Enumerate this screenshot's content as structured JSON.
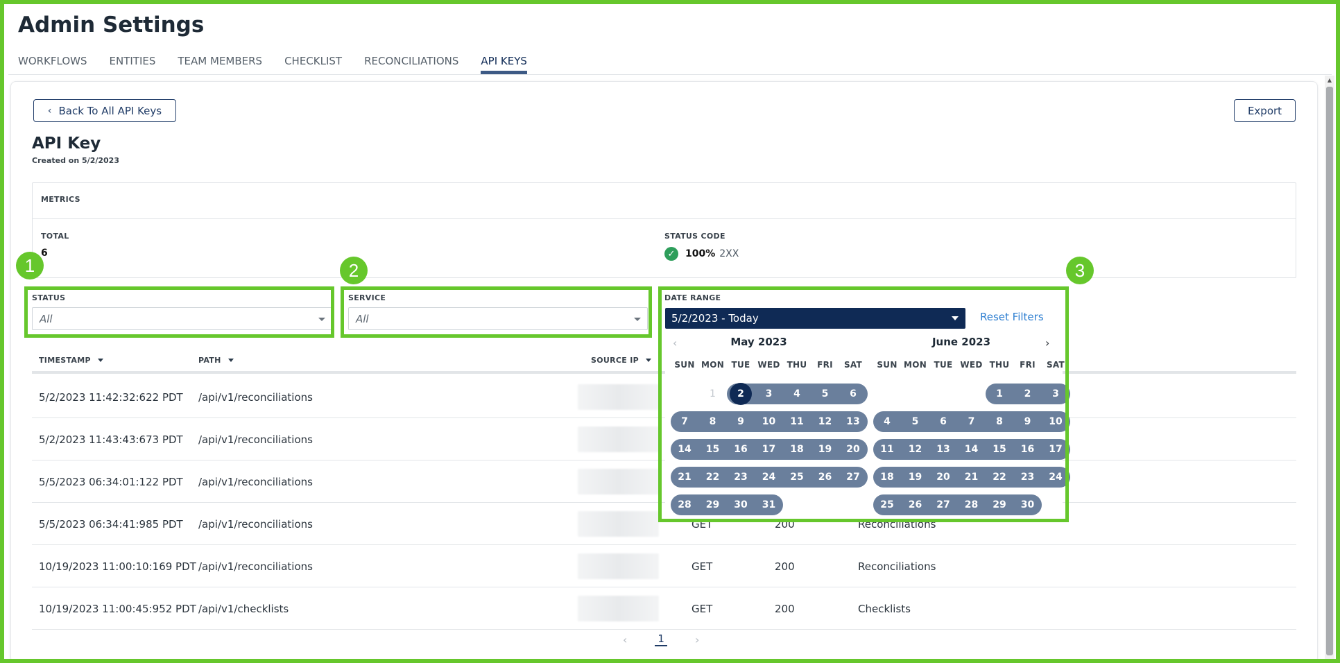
{
  "page": {
    "title": "Admin Settings",
    "tabs": [
      {
        "label": "WORKFLOWS",
        "active": false
      },
      {
        "label": "ENTITIES",
        "active": false
      },
      {
        "label": "TEAM MEMBERS",
        "active": false
      },
      {
        "label": "CHECKLIST",
        "active": false
      },
      {
        "label": "RECONCILIATIONS",
        "active": false
      },
      {
        "label": "API KEYS",
        "active": true
      }
    ]
  },
  "toolbar": {
    "back_label": "Back To All API Keys",
    "back_icon": "chevron-left-icon",
    "export_label": "Export"
  },
  "key": {
    "title": "API Key",
    "created": "Created on 5/2/2023"
  },
  "metrics": {
    "header": "METRICS",
    "total_label": "TOTAL",
    "total_value": "6",
    "status_label": "STATUS CODE",
    "status_percent": "100%",
    "status_class": "2XX",
    "status_icon": "check-circle-icon",
    "status_color": "#2e9e5b"
  },
  "filters": {
    "status": {
      "label": "STATUS",
      "value": "All"
    },
    "service": {
      "label": "SERVICE",
      "value": "All"
    },
    "date_range": {
      "label": "DATE RANGE",
      "value": "5/2/2023 - Today"
    },
    "reset_label": "Reset Filters"
  },
  "annotations": {
    "badge_1": "1",
    "badge_2": "2",
    "badge_3": "3",
    "color": "#66c72c"
  },
  "calendar": {
    "left_month": "May 2023",
    "right_month": "June 2023",
    "weekdays": [
      "SUN",
      "MON",
      "TUE",
      "WED",
      "THU",
      "FRI",
      "SAT"
    ],
    "left_muted_day": "1",
    "selected_day": "2",
    "range_color": "#6a7f9c",
    "selected_color": "#0f2a55"
  },
  "table": {
    "columns": {
      "timestamp": "TIMESTAMP",
      "path": "PATH",
      "source_ip": "SOURCE IP"
    },
    "rows": [
      {
        "timestamp": "5/2/2023 11:42:32:622 PDT",
        "path": "/api/v1/reconciliations",
        "method": "",
        "status": "",
        "service": ""
      },
      {
        "timestamp": "5/2/2023 11:43:43:673 PDT",
        "path": "/api/v1/reconciliations",
        "method": "",
        "status": "",
        "service": ""
      },
      {
        "timestamp": "5/5/2023 06:34:01:122 PDT",
        "path": "/api/v1/reconciliations",
        "method": "",
        "status": "",
        "service": ""
      },
      {
        "timestamp": "5/5/2023 06:34:41:985 PDT",
        "path": "/api/v1/reconciliations",
        "method": "GET",
        "status": "200",
        "service": "Reconciliations"
      },
      {
        "timestamp": "10/19/2023 11:00:10:169 PDT",
        "path": "/api/v1/reconciliations",
        "method": "GET",
        "status": "200",
        "service": "Reconciliations"
      },
      {
        "timestamp": "10/19/2023 11:00:45:952 PDT",
        "path": "/api/v1/checklists",
        "method": "GET",
        "status": "200",
        "service": "Checklists"
      }
    ]
  },
  "pagination": {
    "current_page": "1",
    "prev_icon": "chevron-left-icon",
    "next_icon": "chevron-right-icon"
  }
}
